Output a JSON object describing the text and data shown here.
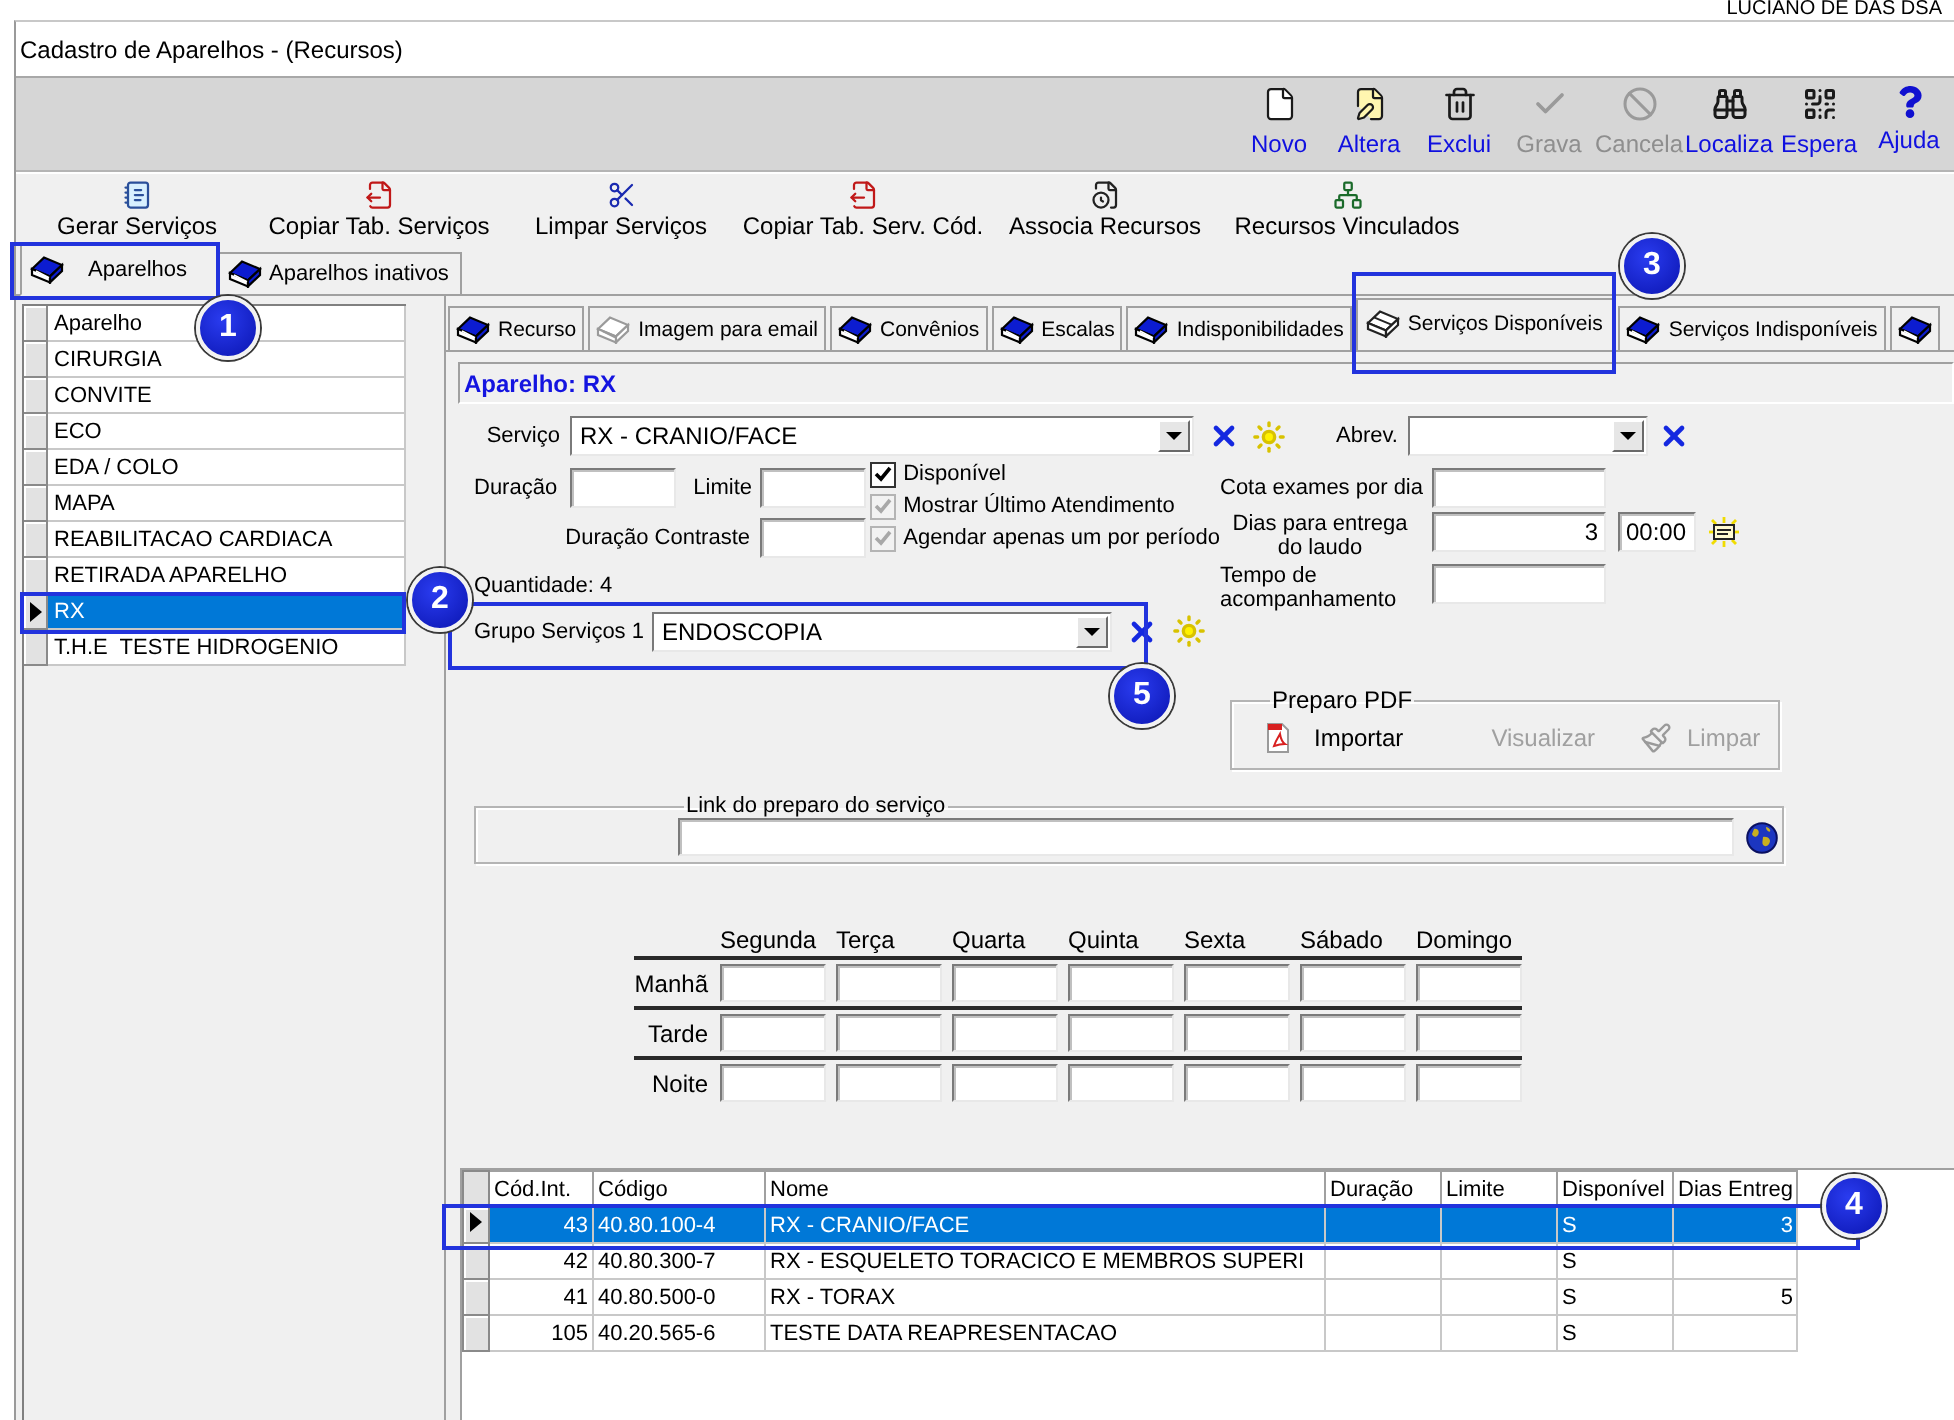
{
  "top_bar": {
    "user": "LUCIANO DE DAS DSA"
  },
  "window": {
    "title": "Cadastro de Aparelhos - (Recursos)"
  },
  "toolbar": [
    {
      "kind": "new",
      "label": "Novo",
      "disabled": false
    },
    {
      "kind": "edit",
      "label": "Altera",
      "disabled": false
    },
    {
      "kind": "delete",
      "label": "Exclui",
      "disabled": false
    },
    {
      "kind": "save",
      "label": "Grava",
      "disabled": true
    },
    {
      "kind": "cancel",
      "label": "Cancela",
      "disabled": true
    },
    {
      "kind": "find",
      "label": "Localiza",
      "disabled": false
    },
    {
      "kind": "wait",
      "label": "Espera",
      "disabled": false
    },
    {
      "kind": "help",
      "label": "Ajuda",
      "disabled": false
    }
  ],
  "actions": [
    {
      "kind": "generate",
      "label": "Gerar Serviços"
    },
    {
      "kind": "copy",
      "label": "Copiar Tab. Serviços"
    },
    {
      "kind": "clear",
      "label": "Limpar Serviços"
    },
    {
      "kind": "copy",
      "label": "Copiar Tab. Serv. Cód."
    },
    {
      "kind": "associate",
      "label": "Associa Recursos"
    },
    {
      "kind": "linked",
      "label": "Recursos Vinculados"
    }
  ],
  "tabs": [
    {
      "label": "Aparelhos",
      "selected": true
    },
    {
      "label": "Aparelhos inativos",
      "selected": false
    }
  ],
  "device_list": {
    "column": "Aparelho",
    "items": [
      {
        "name": "CIRURGIA",
        "selected": false
      },
      {
        "name": "CONVITE",
        "selected": false
      },
      {
        "name": "ECO",
        "selected": false
      },
      {
        "name": "EDA / COLO",
        "selected": false
      },
      {
        "name": "MAPA",
        "selected": false
      },
      {
        "name": "REABILITACAO CARDIACA",
        "selected": false
      },
      {
        "name": "RETIRADA APARELHO",
        "selected": false
      },
      {
        "name": "RX",
        "selected": true
      },
      {
        "name": "T.H.E  TESTE HIDROGENIO",
        "selected": false
      }
    ]
  },
  "sub_tabs": [
    {
      "label": "Recurso",
      "kind": "solid",
      "selected": false
    },
    {
      "label": "Imagem para email",
      "kind": "faded",
      "selected": false
    },
    {
      "label": "Convênios",
      "kind": "solid",
      "selected": false
    },
    {
      "label": "Escalas",
      "kind": "solid",
      "selected": false
    },
    {
      "label": "Indisponibilidades",
      "kind": "solid",
      "selected": false
    },
    {
      "label": "Serviços Disponíveis",
      "kind": "open",
      "selected": true
    },
    {
      "label": "Serviços Indisponíveis",
      "kind": "solid",
      "selected": false
    },
    {
      "kind": "solid",
      "selected": false
    }
  ],
  "panel": {
    "title": "Aparelho: RX",
    "service": {
      "label": "Serviço",
      "value": "RX - CRANIO/FACE"
    },
    "abbrev": {
      "label": "Abrev."
    },
    "duration": {
      "label": "Duração"
    },
    "limit": {
      "label": "Limite"
    },
    "contrast_duration": {
      "label": "Duração Contraste"
    },
    "checkboxes": [
      {
        "label": "Disponível",
        "checked": true,
        "disabled": false
      },
      {
        "label": "Mostrar Último Atendimento",
        "checked": true,
        "disabled": true
      },
      {
        "label": "Agendar apenas um por período",
        "checked": true,
        "disabled": true
      }
    ],
    "quantity": "Quantidade: 4",
    "group": {
      "label": "Grupo Serviços 1",
      "value": "ENDOSCOPIA"
    },
    "daily_quota": {
      "label": "Cota exames por dia"
    },
    "delivery_days": {
      "label": "Dias para entrega do laudo",
      "value": "3",
      "time": "00:00"
    },
    "follow_up": {
      "label": "Tempo de acompanhamento"
    },
    "pdf_group": {
      "title": "Preparo PDF",
      "buttons": [
        {
          "kind": "import",
          "label": "Importar",
          "disabled": false
        },
        {
          "kind": "view",
          "label": "Visualizar",
          "disabled": true
        },
        {
          "kind": "clear",
          "label": "Limpar",
          "disabled": true
        }
      ]
    },
    "link": {
      "title": "Link do preparo do serviço"
    }
  },
  "schedule": {
    "days": [
      "Segunda",
      "Terça",
      "Quarta",
      "Quinta",
      "Sexta",
      "Sábado",
      "Domingo"
    ],
    "periods": [
      "Manhã",
      "Tarde",
      "Noite"
    ]
  },
  "services_table": {
    "columns": [
      "Cód.Int.",
      "Código",
      "Nome",
      "Duração",
      "Limite",
      "Disponível",
      "Dias Entreg"
    ],
    "rows": [
      {
        "cells": [
          "43",
          "40.80.100-4",
          "RX - CRANIO/FACE",
          null,
          null,
          "S",
          "3"
        ],
        "selected": true
      },
      {
        "cells": [
          "42",
          "40.80.300-7",
          "RX - ESQUELETO TORACICO E MEMBROS SUPERI",
          null,
          null,
          "S",
          null
        ],
        "selected": false
      },
      {
        "cells": [
          "41",
          "40.80.500-0",
          "RX - TORAX",
          null,
          null,
          "S",
          "5"
        ],
        "selected": false
      },
      {
        "cells": [
          "105",
          "40.20.565-6",
          "TESTE DATA REAPRESENTACAO",
          null,
          null,
          "S",
          null
        ],
        "selected": false
      }
    ]
  },
  "callouts": [
    {
      "label": "1"
    },
    {
      "label": "2"
    },
    {
      "label": "3"
    },
    {
      "label": "4"
    },
    {
      "label": "5"
    }
  ]
}
